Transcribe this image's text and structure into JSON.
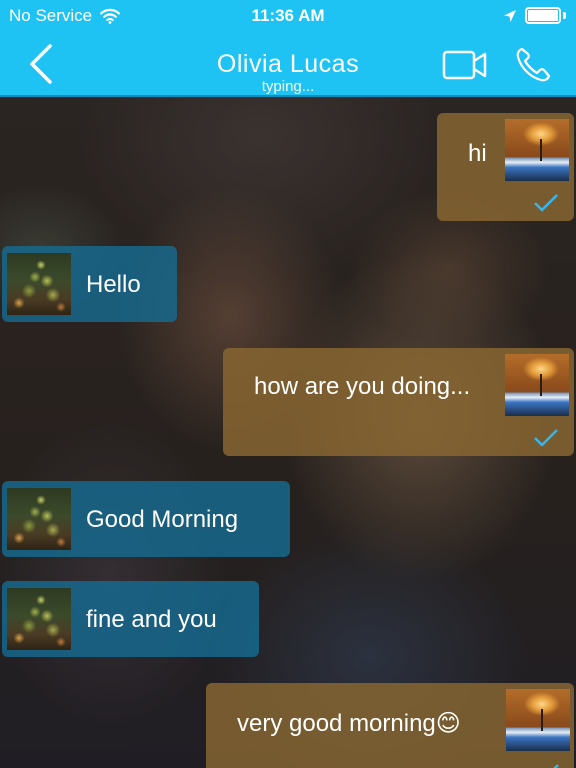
{
  "status_bar": {
    "carrier": "No Service",
    "time": "11:36 AM"
  },
  "header": {
    "contact_name": "Olivia Lucas",
    "status": "typing..."
  },
  "messages": [
    {
      "direction": "outgoing",
      "text": "hi",
      "read": true
    },
    {
      "direction": "incoming",
      "text": "Hello"
    },
    {
      "direction": "outgoing",
      "text": "how are you doing...",
      "read": true
    },
    {
      "direction": "incoming",
      "text": "Good Morning"
    },
    {
      "direction": "incoming",
      "text": "fine and you"
    },
    {
      "direction": "outgoing",
      "text": "very good morning😊",
      "read": true
    }
  ],
  "colors": {
    "accent": "#1ec3f3",
    "incoming_bubble": "#146e96",
    "outgoing_bubble": "#8a6832",
    "read_check": "#35b7ee"
  },
  "icons": {
    "wifi": "wifi-icon",
    "location": "location-arrow-icon",
    "battery": "battery-icon",
    "back": "chevron-left-icon",
    "video": "video-camera-icon",
    "call": "phone-icon",
    "read": "checkmark-icon"
  }
}
